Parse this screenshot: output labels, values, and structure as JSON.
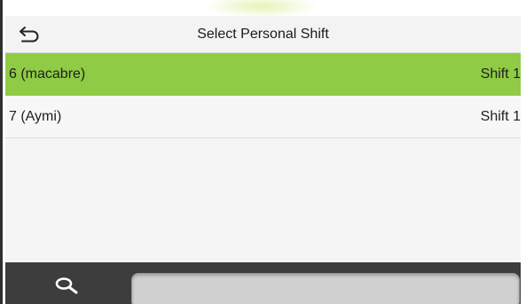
{
  "header": {
    "title": "Select Personal Shift",
    "back_icon": "back-arrow-icon"
  },
  "list": {
    "rows": [
      {
        "name": "6 (macabre)",
        "shift": "Shift 1",
        "selected": true
      },
      {
        "name": "7 (Aymi)",
        "shift": "Shift 1",
        "selected": false
      }
    ]
  },
  "bottom": {
    "search_icon": "search-icon",
    "search_value": ""
  },
  "colors": {
    "selected_row": "#8fcb44",
    "header_bg": "#f3f3f3",
    "bottom_bar": "#3d3d3d",
    "search_field": "#d0d0d0"
  }
}
